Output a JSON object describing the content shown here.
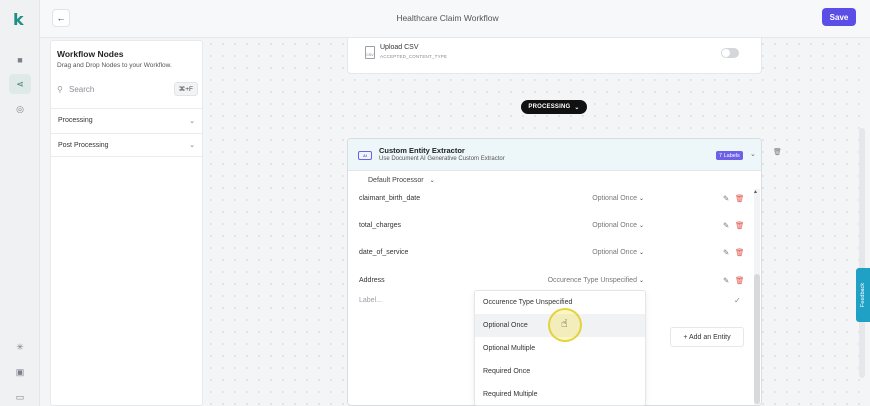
{
  "app": {
    "logo": "k",
    "rail_icons": [
      "folder-icon",
      "workflow-icon",
      "shield-icon",
      "sun-icon",
      "document-icon",
      "monitor-icon"
    ]
  },
  "topbar": {
    "back_label": "←",
    "title": "Healthcare Claim Workflow",
    "save_label": "Save"
  },
  "nodes_panel": {
    "title": "Workflow Nodes",
    "subtitle": "Drag and Drop Nodes to your Workflow.",
    "search_placeholder": "Search",
    "search_shortcut": "⌘+F",
    "sections": [
      {
        "label": "Processing"
      },
      {
        "label": "Post Processing"
      }
    ]
  },
  "upload_node": {
    "icon_text": "CSV",
    "title": "Upload CSV",
    "subtitle": "ACCEPTED_CONTENT_TYPE"
  },
  "stage_pill": {
    "label": "PROCESSING"
  },
  "extractor": {
    "icon_text": "AI",
    "title": "Custom Entity Extractor",
    "subtitle": "Use Document AI Generative Custom Extractor",
    "labels_badge": "7 Labels",
    "processor_select": "Default Processor",
    "entities": [
      {
        "name": "claimant_birth_date",
        "occurrence": "Optional Once"
      },
      {
        "name": "total_charges",
        "occurrence": "Optional Once"
      },
      {
        "name": "date_of_service",
        "occurrence": "Optional Once"
      },
      {
        "name": "Address",
        "occurrence": "Occurence Type Unspecified"
      }
    ],
    "label_placeholder": "Label...",
    "add_entity_label": "+ Add an Entity"
  },
  "occurrence_dropdown": {
    "options": [
      "Occurence Type Unspecified",
      "Optional Once",
      "Optional Multiple",
      "Required Once",
      "Required Multiple"
    ],
    "hovered": "Optional Once"
  },
  "feedback_tab": {
    "label": "Feedback"
  },
  "colors": {
    "accent": "#5b4ee6",
    "brand": "#1d8f84",
    "danger": "#e0534a",
    "feedback": "#1fa1c6"
  }
}
